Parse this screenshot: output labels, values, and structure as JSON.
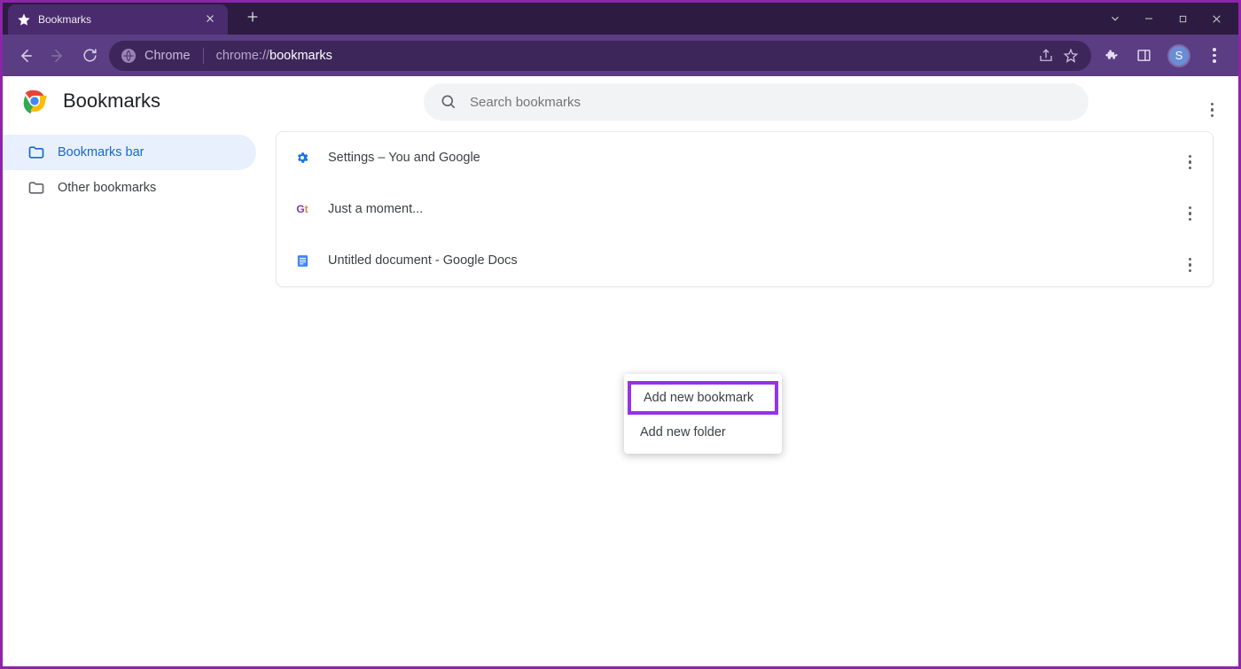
{
  "browser": {
    "tab_title": "Bookmarks",
    "url_scheme_label": "Chrome",
    "url_scheme": "chrome://",
    "url_path": "bookmarks",
    "avatar_letter": "S"
  },
  "page": {
    "title": "Bookmarks",
    "search_placeholder": "Search bookmarks"
  },
  "sidebar": {
    "items": [
      {
        "label": "Bookmarks bar",
        "active": true
      },
      {
        "label": "Other bookmarks",
        "active": false
      }
    ]
  },
  "bookmarks": [
    {
      "title": "Settings – You and Google",
      "favicon": "gear"
    },
    {
      "title": "Just a moment...",
      "favicon": "gt"
    },
    {
      "title": "Untitled document - Google Docs",
      "favicon": "docs"
    }
  ],
  "context_menu": {
    "items": [
      {
        "label": "Add new bookmark",
        "highlighted": true
      },
      {
        "label": "Add new folder",
        "highlighted": false
      }
    ]
  }
}
